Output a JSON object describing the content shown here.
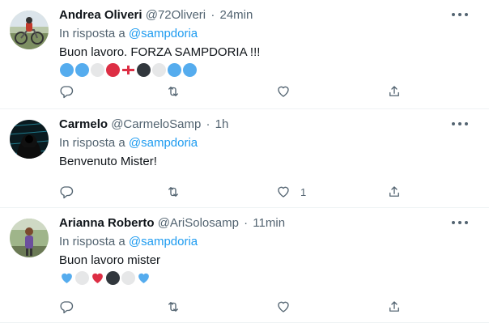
{
  "tweets": [
    {
      "display_name": "Andrea Oliveri",
      "handle": "@72Oliveri",
      "separator": "·",
      "time": "24min",
      "reply_prefix": "In risposta a",
      "reply_to": "@sampdoria",
      "text": "Buon lavoro. FORZA SAMPDORIA !!!",
      "like_count": "",
      "emojis": [
        "blue-circle",
        "blue-circle",
        "white-circle",
        "red-circle",
        "cross-flag",
        "black-circle",
        "white-circle",
        "blue-circle",
        "blue-circle"
      ]
    },
    {
      "display_name": "Carmelo",
      "handle": "@CarmeloSamp",
      "separator": "·",
      "time": "1h",
      "reply_prefix": "In risposta a",
      "reply_to": "@sampdoria",
      "text": "Benvenuto Mister!",
      "like_count": "1",
      "emojis": []
    },
    {
      "display_name": "Arianna Roberto",
      "handle": "@AriSolosamp",
      "separator": "·",
      "time": "11min",
      "reply_prefix": "In risposta a",
      "reply_to": "@sampdoria",
      "text": "Buon lavoro mister",
      "like_count": "",
      "emojis": [
        "blue-heart",
        "white-circle",
        "red-heart",
        "black-circle",
        "white-circle",
        "blue-heart"
      ]
    }
  ],
  "colors": {
    "link": "#1d9bf0",
    "secondary_text": "#536471",
    "emoji_blue": "#55acee",
    "emoji_red": "#dd2e44",
    "emoji_black": "#31373d",
    "emoji_white": "#e6e7e8"
  },
  "icons": {
    "reply": "reply-icon",
    "retweet": "retweet-icon",
    "like": "heart-icon",
    "share": "share-icon",
    "more": "more-icon"
  }
}
